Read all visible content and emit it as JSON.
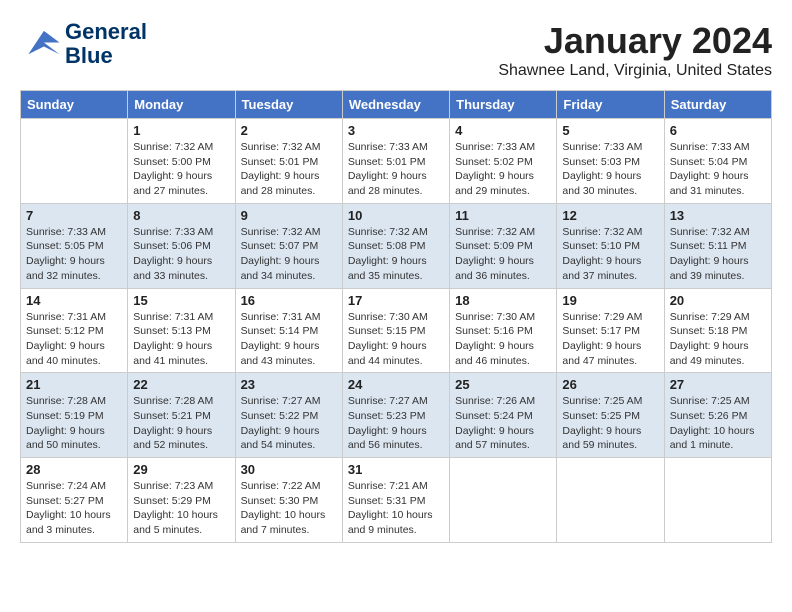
{
  "header": {
    "logo_line1": "General",
    "logo_line2": "Blue",
    "month": "January 2024",
    "location": "Shawnee Land, Virginia, United States"
  },
  "weekdays": [
    "Sunday",
    "Monday",
    "Tuesday",
    "Wednesday",
    "Thursday",
    "Friday",
    "Saturday"
  ],
  "weeks": [
    [
      {
        "day": "",
        "info": ""
      },
      {
        "day": "1",
        "info": "Sunrise: 7:32 AM\nSunset: 5:00 PM\nDaylight: 9 hours\nand 27 minutes."
      },
      {
        "day": "2",
        "info": "Sunrise: 7:32 AM\nSunset: 5:01 PM\nDaylight: 9 hours\nand 28 minutes."
      },
      {
        "day": "3",
        "info": "Sunrise: 7:33 AM\nSunset: 5:01 PM\nDaylight: 9 hours\nand 28 minutes."
      },
      {
        "day": "4",
        "info": "Sunrise: 7:33 AM\nSunset: 5:02 PM\nDaylight: 9 hours\nand 29 minutes."
      },
      {
        "day": "5",
        "info": "Sunrise: 7:33 AM\nSunset: 5:03 PM\nDaylight: 9 hours\nand 30 minutes."
      },
      {
        "day": "6",
        "info": "Sunrise: 7:33 AM\nSunset: 5:04 PM\nDaylight: 9 hours\nand 31 minutes."
      }
    ],
    [
      {
        "day": "7",
        "info": "Sunrise: 7:33 AM\nSunset: 5:05 PM\nDaylight: 9 hours\nand 32 minutes."
      },
      {
        "day": "8",
        "info": "Sunrise: 7:33 AM\nSunset: 5:06 PM\nDaylight: 9 hours\nand 33 minutes."
      },
      {
        "day": "9",
        "info": "Sunrise: 7:32 AM\nSunset: 5:07 PM\nDaylight: 9 hours\nand 34 minutes."
      },
      {
        "day": "10",
        "info": "Sunrise: 7:32 AM\nSunset: 5:08 PM\nDaylight: 9 hours\nand 35 minutes."
      },
      {
        "day": "11",
        "info": "Sunrise: 7:32 AM\nSunset: 5:09 PM\nDaylight: 9 hours\nand 36 minutes."
      },
      {
        "day": "12",
        "info": "Sunrise: 7:32 AM\nSunset: 5:10 PM\nDaylight: 9 hours\nand 37 minutes."
      },
      {
        "day": "13",
        "info": "Sunrise: 7:32 AM\nSunset: 5:11 PM\nDaylight: 9 hours\nand 39 minutes."
      }
    ],
    [
      {
        "day": "14",
        "info": "Sunrise: 7:31 AM\nSunset: 5:12 PM\nDaylight: 9 hours\nand 40 minutes."
      },
      {
        "day": "15",
        "info": "Sunrise: 7:31 AM\nSunset: 5:13 PM\nDaylight: 9 hours\nand 41 minutes."
      },
      {
        "day": "16",
        "info": "Sunrise: 7:31 AM\nSunset: 5:14 PM\nDaylight: 9 hours\nand 43 minutes."
      },
      {
        "day": "17",
        "info": "Sunrise: 7:30 AM\nSunset: 5:15 PM\nDaylight: 9 hours\nand 44 minutes."
      },
      {
        "day": "18",
        "info": "Sunrise: 7:30 AM\nSunset: 5:16 PM\nDaylight: 9 hours\nand 46 minutes."
      },
      {
        "day": "19",
        "info": "Sunrise: 7:29 AM\nSunset: 5:17 PM\nDaylight: 9 hours\nand 47 minutes."
      },
      {
        "day": "20",
        "info": "Sunrise: 7:29 AM\nSunset: 5:18 PM\nDaylight: 9 hours\nand 49 minutes."
      }
    ],
    [
      {
        "day": "21",
        "info": "Sunrise: 7:28 AM\nSunset: 5:19 PM\nDaylight: 9 hours\nand 50 minutes."
      },
      {
        "day": "22",
        "info": "Sunrise: 7:28 AM\nSunset: 5:21 PM\nDaylight: 9 hours\nand 52 minutes."
      },
      {
        "day": "23",
        "info": "Sunrise: 7:27 AM\nSunset: 5:22 PM\nDaylight: 9 hours\nand 54 minutes."
      },
      {
        "day": "24",
        "info": "Sunrise: 7:27 AM\nSunset: 5:23 PM\nDaylight: 9 hours\nand 56 minutes."
      },
      {
        "day": "25",
        "info": "Sunrise: 7:26 AM\nSunset: 5:24 PM\nDaylight: 9 hours\nand 57 minutes."
      },
      {
        "day": "26",
        "info": "Sunrise: 7:25 AM\nSunset: 5:25 PM\nDaylight: 9 hours\nand 59 minutes."
      },
      {
        "day": "27",
        "info": "Sunrise: 7:25 AM\nSunset: 5:26 PM\nDaylight: 10 hours\nand 1 minute."
      }
    ],
    [
      {
        "day": "28",
        "info": "Sunrise: 7:24 AM\nSunset: 5:27 PM\nDaylight: 10 hours\nand 3 minutes."
      },
      {
        "day": "29",
        "info": "Sunrise: 7:23 AM\nSunset: 5:29 PM\nDaylight: 10 hours\nand 5 minutes."
      },
      {
        "day": "30",
        "info": "Sunrise: 7:22 AM\nSunset: 5:30 PM\nDaylight: 10 hours\nand 7 minutes."
      },
      {
        "day": "31",
        "info": "Sunrise: 7:21 AM\nSunset: 5:31 PM\nDaylight: 10 hours\nand 9 minutes."
      },
      {
        "day": "",
        "info": ""
      },
      {
        "day": "",
        "info": ""
      },
      {
        "day": "",
        "info": ""
      }
    ]
  ]
}
